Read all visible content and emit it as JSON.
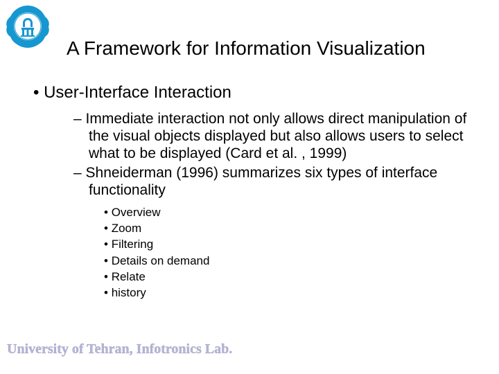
{
  "logo": {
    "name": "university-emblem"
  },
  "title": "A Framework for Information Visualization",
  "bullets": {
    "level1": "User-Interface Interaction",
    "level2": [
      "Immediate interaction not only allows direct manipulation of the visual objects displayed but also allows users to select what to be displayed (Card et al. , 1999)",
      "Shneiderman (1996) summarizes six types of interface functionality"
    ],
    "level3": [
      "Overview",
      "Zoom",
      "Filtering",
      "Details on demand",
      "Relate",
      "history"
    ]
  },
  "footer": "University of Tehran, Infotronics Lab."
}
